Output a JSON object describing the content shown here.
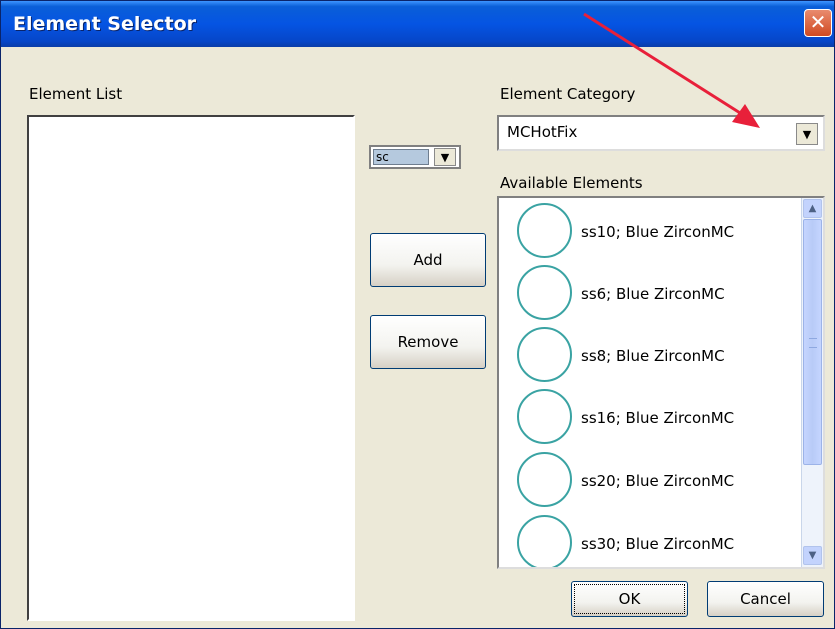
{
  "window": {
    "title": "Element Selector",
    "close_glyph": "✕"
  },
  "element_list": {
    "label": "Element List",
    "items": []
  },
  "small_select": {
    "value": "sc",
    "arrow_glyph": "▼"
  },
  "buttons": {
    "add": "Add",
    "remove": "Remove",
    "ok": "OK",
    "cancel": "Cancel"
  },
  "category": {
    "label": "Element Category",
    "value": "MCHotFix",
    "arrow_glyph": "▼"
  },
  "available": {
    "label": "Available Elements",
    "items": [
      {
        "label": "ss10; Blue ZirconMC"
      },
      {
        "label": "ss6; Blue ZirconMC"
      },
      {
        "label": "ss8; Blue ZirconMC"
      },
      {
        "label": "ss16; Blue ZirconMC"
      },
      {
        "label": "ss20; Blue ZirconMC"
      },
      {
        "label": "ss30; Blue ZirconMC"
      }
    ],
    "scroll_up_glyph": "▲",
    "scroll_down_glyph": "▼"
  },
  "colors": {
    "titlebar": "#0554e3",
    "annotation_arrow": "#e8203a",
    "item_circle": "#3aa3a3"
  },
  "icons": {
    "close": "close-icon",
    "annotation": "red-arrow-annotation",
    "item": "circle-icon"
  }
}
